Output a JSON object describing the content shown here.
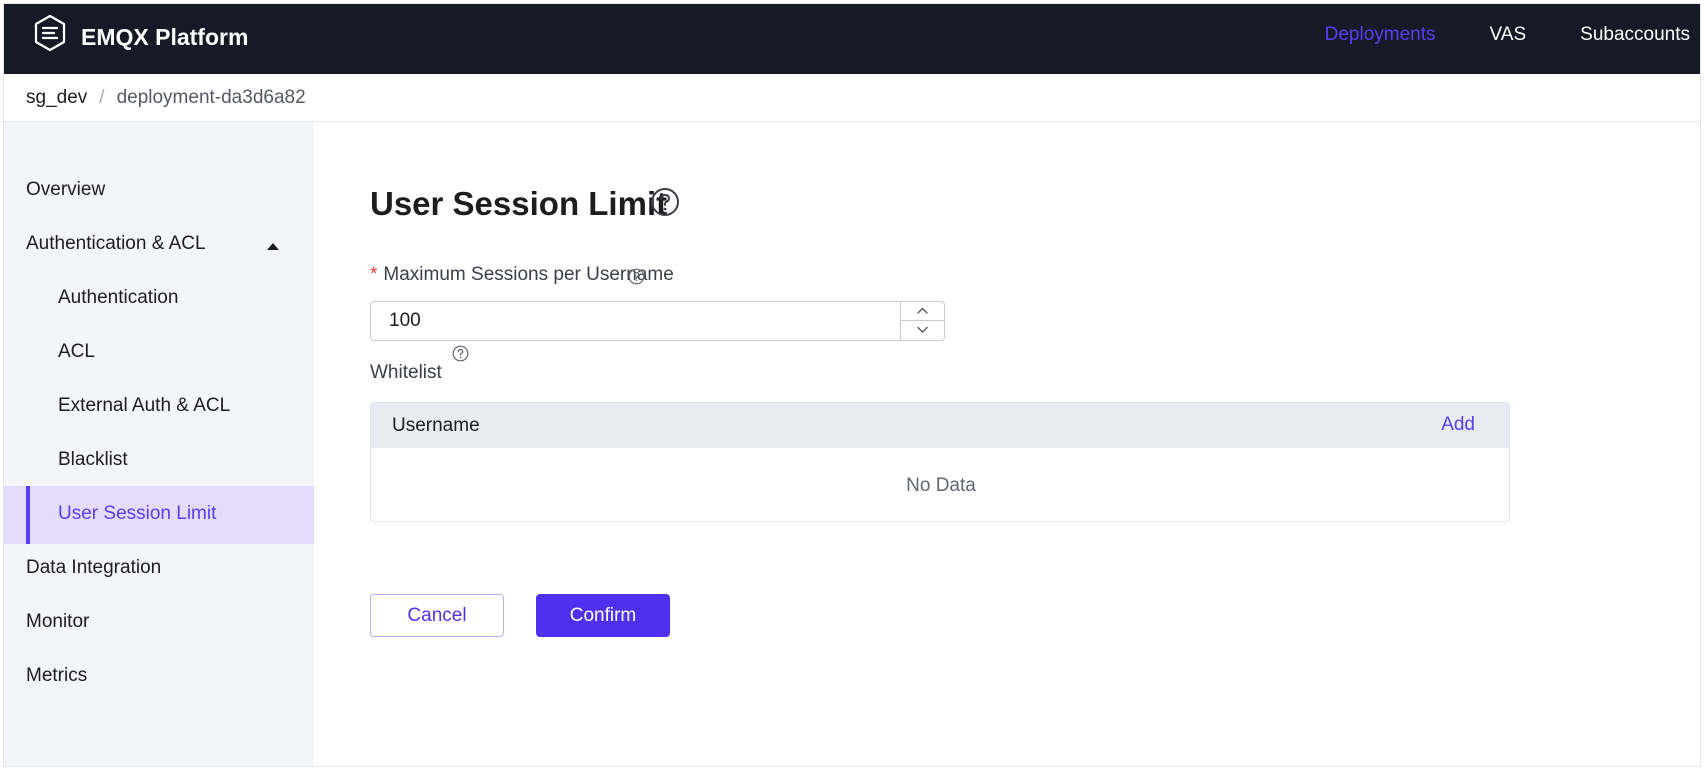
{
  "topbar": {
    "brand": "EMQX Platform",
    "nav": [
      {
        "label": "Deployments",
        "active": true
      },
      {
        "label": "VAS",
        "active": false
      },
      {
        "label": "Subaccounts",
        "active": false
      }
    ]
  },
  "breadcrumb": {
    "items": [
      "sg_dev",
      "deployment-da3d6a82"
    ],
    "separator": "/"
  },
  "sidebar": {
    "items": [
      {
        "label": "Overview",
        "level": 1
      },
      {
        "label": "Authentication & ACL",
        "level": 1,
        "expanded": true
      },
      {
        "label": "Authentication",
        "level": 2
      },
      {
        "label": "ACL",
        "level": 2
      },
      {
        "label": "External Auth & ACL",
        "level": 2
      },
      {
        "label": "Blacklist",
        "level": 2
      },
      {
        "label": "User Session Limit",
        "level": 2,
        "active": true
      },
      {
        "label": "Data Integration",
        "level": 1
      },
      {
        "label": "Monitor",
        "level": 1
      },
      {
        "label": "Metrics",
        "level": 1
      }
    ]
  },
  "main": {
    "title": "User Session Limit",
    "max_sessions": {
      "required_mark": "*",
      "label": "Maximum Sessions per Username",
      "value": "100"
    },
    "whitelist": {
      "label": "Whitelist",
      "column_header": "Username",
      "add_label": "Add",
      "empty_text": "No Data"
    },
    "actions": {
      "cancel_label": "Cancel",
      "confirm_label": "Confirm"
    }
  },
  "colors": {
    "accent": "#5b3cf5",
    "topbar_bg": "#171a26",
    "sidebar_bg": "#f4f5f9",
    "active_item_bg": "#e3dcfd",
    "required": "#e8403a"
  }
}
